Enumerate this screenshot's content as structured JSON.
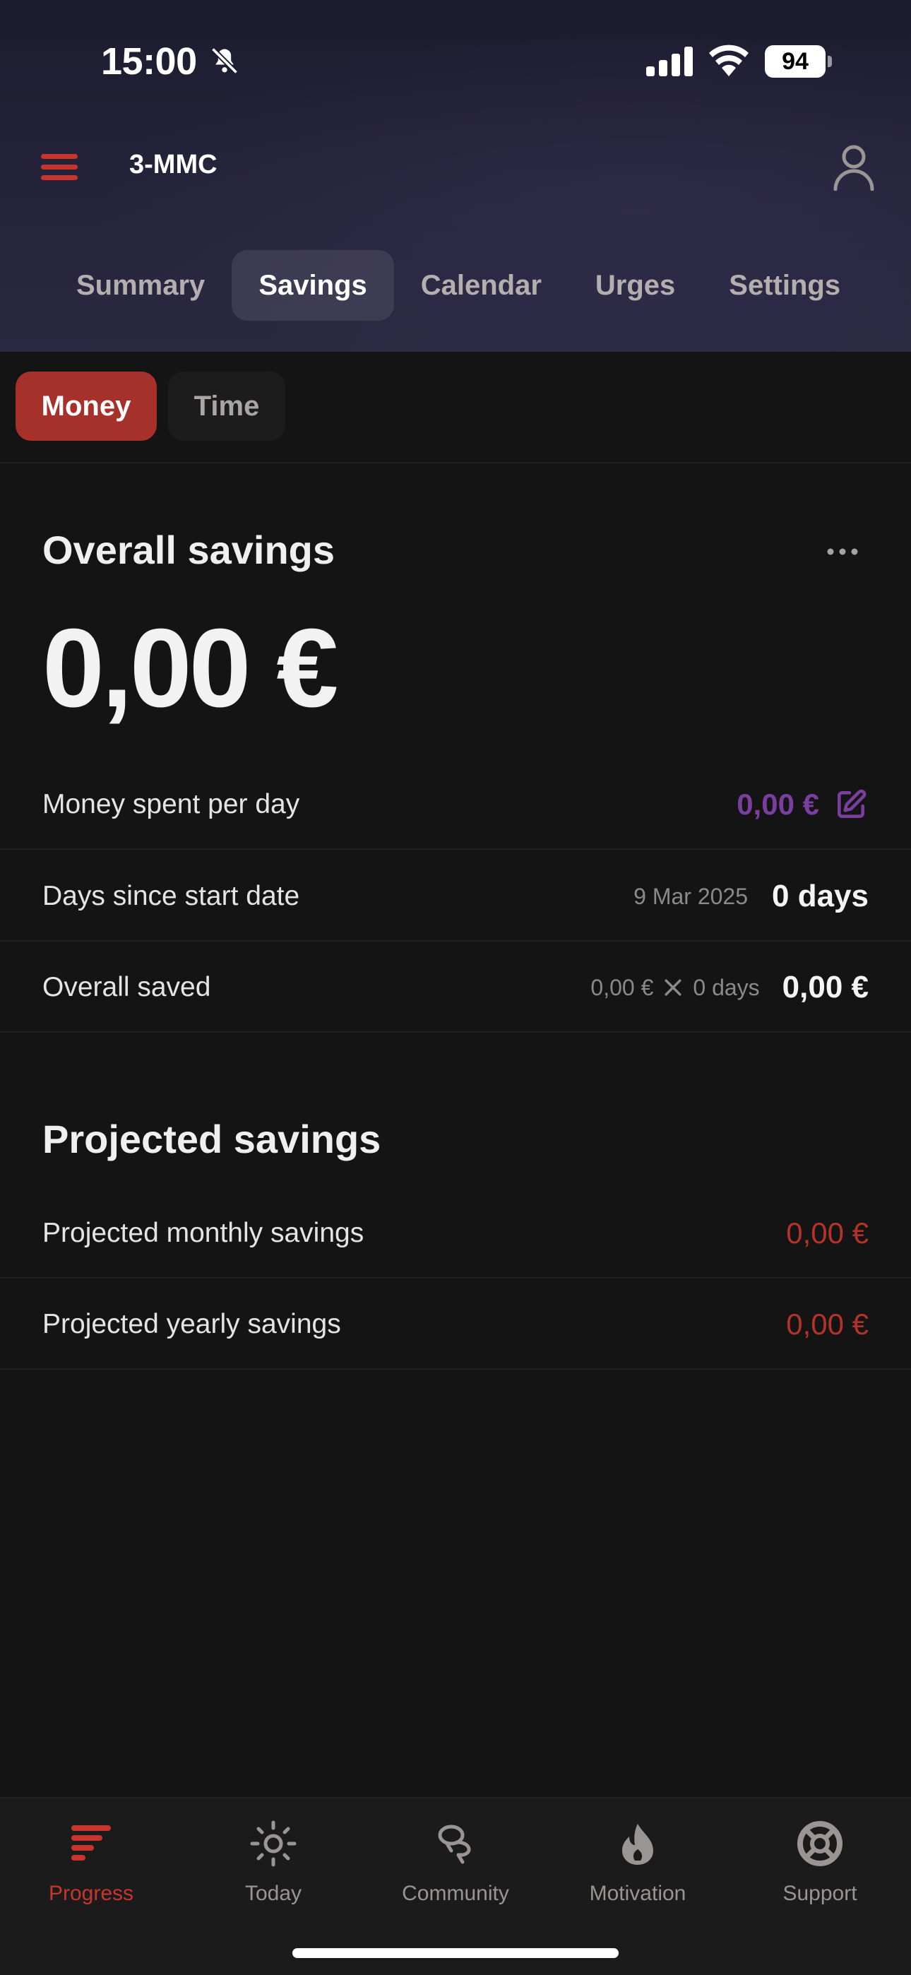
{
  "status_bar": {
    "time": "15:00",
    "battery": "94"
  },
  "header": {
    "app_title": "3-MMC"
  },
  "tabs": [
    {
      "label": "Summary",
      "active": false
    },
    {
      "label": "Savings",
      "active": true
    },
    {
      "label": "Calendar",
      "active": false
    },
    {
      "label": "Urges",
      "active": false
    },
    {
      "label": "Settings",
      "active": false
    }
  ],
  "sub_tabs": [
    {
      "label": "Money",
      "active": true
    },
    {
      "label": "Time",
      "active": false
    }
  ],
  "overall": {
    "title": "Overall savings",
    "amount": "0,00 €",
    "rows": {
      "spent": {
        "label": "Money spent per day",
        "value": "0,00 €"
      },
      "days": {
        "label": "Days since start date",
        "date": "9 Mar 2025",
        "value": "0 days"
      },
      "saved": {
        "label": "Overall saved",
        "formula_left": "0,00 €",
        "formula_right": "0 days",
        "value": "0,00 €"
      }
    }
  },
  "projected": {
    "title": "Projected savings",
    "monthly": {
      "label": "Projected monthly savings",
      "value": "0,00 €"
    },
    "yearly": {
      "label": "Projected yearly savings",
      "value": "0,00 €"
    }
  },
  "bottom_nav": [
    {
      "label": "Progress",
      "icon": "progress-bars-icon",
      "active": true
    },
    {
      "label": "Today",
      "icon": "sun-icon",
      "active": false
    },
    {
      "label": "Community",
      "icon": "community-icon",
      "active": false
    },
    {
      "label": "Motivation",
      "icon": "flame-icon",
      "active": false
    },
    {
      "label": "Support",
      "icon": "lifebuoy-icon",
      "active": false
    }
  ],
  "colors": {
    "accent_red": "#c8352d",
    "active_subtab": "#a5312a",
    "purple": "#7a3f9e",
    "background": "#141414"
  }
}
